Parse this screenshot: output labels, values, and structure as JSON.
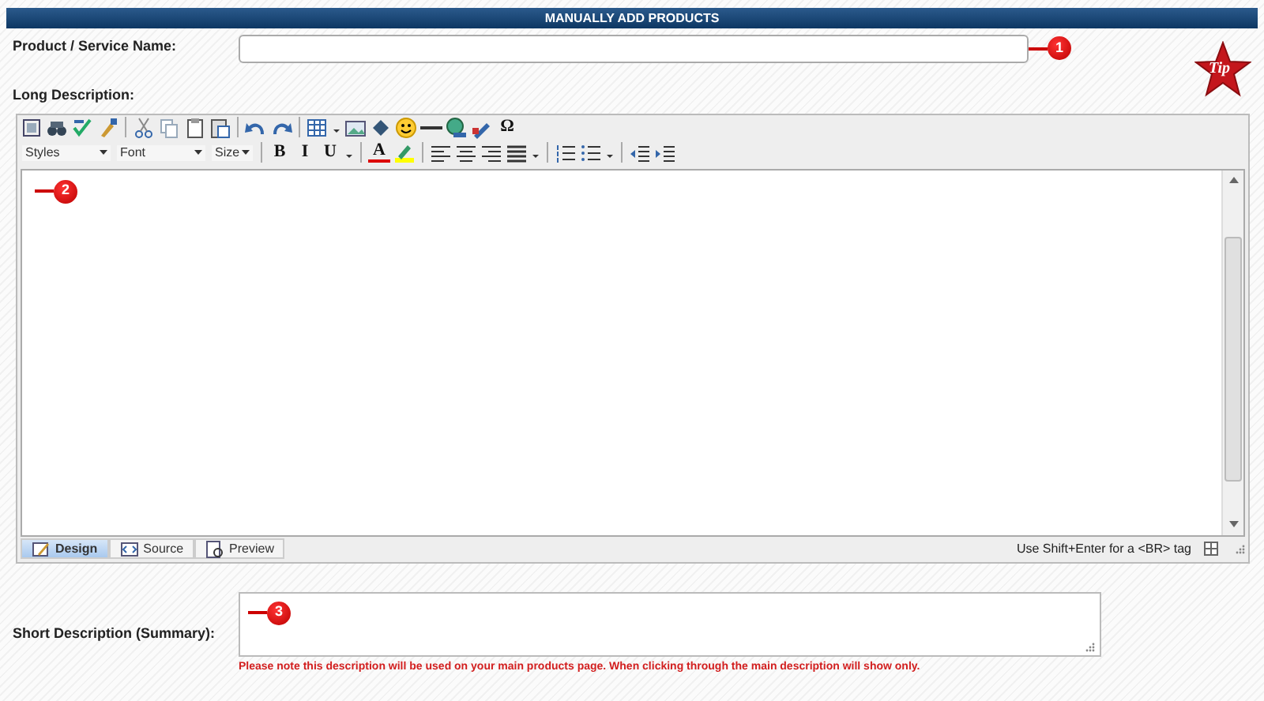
{
  "header": {
    "title": "MANUALLY ADD PRODUCTS"
  },
  "product_name": {
    "label": "Product / Service Name:",
    "callout": "1"
  },
  "tip": {
    "text": "Tip"
  },
  "long_description": {
    "label": "Long Description:",
    "callout": "2",
    "toolbar_rows": [
      [
        {
          "kind": "icon"
        },
        {
          "kind": "icon"
        },
        {
          "kind": "icon"
        },
        {
          "kind": "icon"
        },
        {
          "kind": "separator"
        },
        {
          "kind": "icon"
        },
        {
          "kind": "icon"
        },
        {
          "kind": "icon"
        },
        {
          "kind": "icon"
        },
        {
          "kind": "separator"
        },
        {
          "kind": "icon"
        },
        {
          "kind": "icon"
        },
        {
          "kind": "separator"
        },
        {
          "kind": "icon"
        },
        {
          "kind": "caret"
        },
        {
          "kind": "icon"
        },
        {
          "kind": "icon"
        },
        {
          "kind": "icon"
        },
        {
          "kind": "icon"
        },
        {
          "kind": "icon"
        },
        {
          "kind": "icon"
        },
        {
          "kind": "glyph",
          "text": "Ω"
        }
      ],
      [
        {
          "kind": "dropdown",
          "text": "Styles",
          "wide": true
        },
        {
          "kind": "dropdown",
          "text": "Font",
          "wide": true
        },
        {
          "kind": "dropdown",
          "text": "Size",
          "wide": false
        },
        {
          "kind": "separator"
        },
        {
          "kind": "glyph",
          "text": "B"
        },
        {
          "kind": "glyph",
          "text": "I"
        },
        {
          "kind": "glyph",
          "text": "U"
        },
        {
          "kind": "caret"
        },
        {
          "kind": "separator"
        },
        {
          "kind": "glyph",
          "text": "A"
        },
        {
          "kind": "icon"
        },
        {
          "kind": "separator"
        },
        {
          "kind": "icon"
        },
        {
          "kind": "icon"
        },
        {
          "kind": "icon"
        },
        {
          "kind": "icon"
        },
        {
          "kind": "caret"
        },
        {
          "kind": "separator"
        },
        {
          "kind": "icon"
        },
        {
          "kind": "icon"
        },
        {
          "kind": "caret"
        },
        {
          "kind": "separator"
        },
        {
          "kind": "icon"
        },
        {
          "kind": "icon"
        }
      ]
    ],
    "tabs": [
      {
        "label": "Design",
        "selected": true
      },
      {
        "label": "Source",
        "selected": false
      },
      {
        "label": "Preview",
        "selected": false
      }
    ],
    "status": "Use Shift+Enter for a <BR> tag"
  },
  "short_description": {
    "label": "Short Description (Summary):",
    "callout": "3",
    "note": "Please note this description will be used on your main products page. When clicking through the main description will show only."
  }
}
